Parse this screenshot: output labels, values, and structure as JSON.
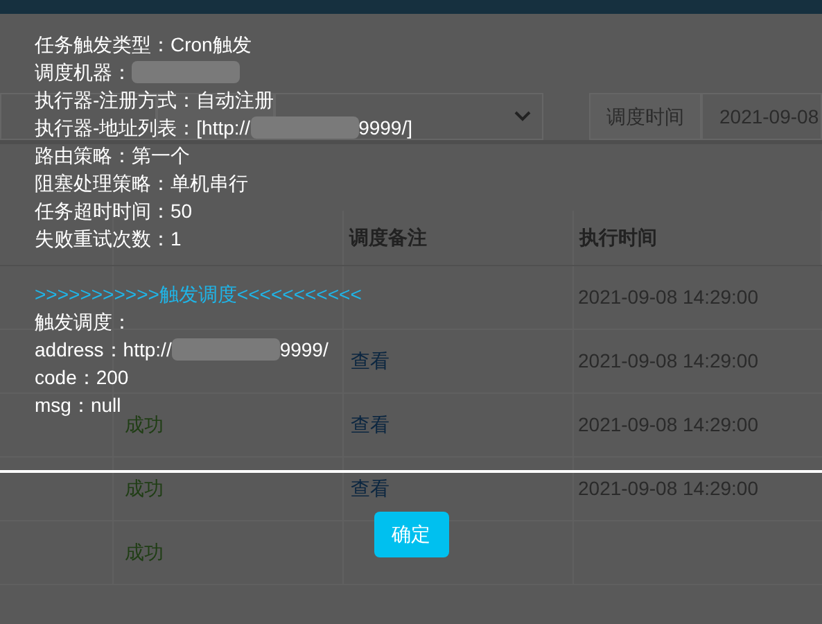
{
  "toolbar": {
    "addon_label": "调度时间",
    "date_value": "2021-09-08"
  },
  "table": {
    "headers": [
      "调度备注",
      "执行时间"
    ],
    "rows": [
      {
        "time": "2021-09-08 14:29:00"
      },
      {
        "action": "查看",
        "time": "2021-09-08 14:29:00"
      },
      {
        "status": "成功",
        "action": "查看",
        "time": "2021-09-08 14:29:00"
      },
      {
        "status": "成功",
        "action": "查看",
        "time": "2021-09-08 14:29:00"
      },
      {
        "status": "成功"
      }
    ]
  },
  "dialog": {
    "lines": [
      {
        "kind": "text",
        "text": "任务触发类型：Cron触发"
      },
      {
        "kind": "redacted",
        "before": "调度机器："
      },
      {
        "kind": "text",
        "text": "执行器-注册方式：自动注册"
      },
      {
        "kind": "redacted",
        "before": "执行器-地址列表：[http://",
        "after": "9999/]"
      },
      {
        "kind": "text",
        "text": "路由策略：第一个"
      },
      {
        "kind": "text",
        "text": "阻塞处理策略：单机串行"
      },
      {
        "kind": "text",
        "text": "任务超时时间：50"
      },
      {
        "kind": "text",
        "text": "失败重试次数：1"
      },
      {
        "kind": "blank"
      },
      {
        "kind": "heading",
        "text": ">>>>>>>>>>>触发调度<<<<<<<<<<<"
      },
      {
        "kind": "text",
        "text": "触发调度："
      },
      {
        "kind": "redacted",
        "before": "address：http://",
        "after": "9999/"
      },
      {
        "kind": "text",
        "text": "code：200"
      },
      {
        "kind": "text",
        "text": "msg：null"
      }
    ],
    "ok_button": "确定"
  }
}
